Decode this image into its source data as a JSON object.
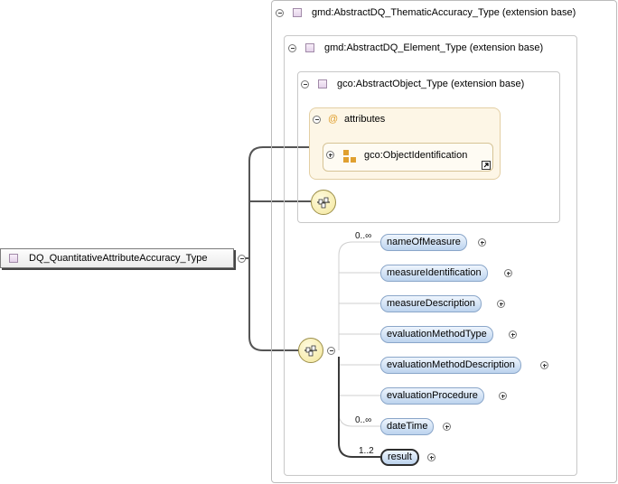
{
  "frames": {
    "outer": "gmd:AbstractDQ_ThematicAccuracy_Type (extension base)",
    "mid": "gmd:AbstractDQ_Element_Type (extension base)",
    "inner": "gco:AbstractObject_Type (extension base)"
  },
  "attributes": {
    "group_label": "attributes",
    "group_symbol": "@",
    "item_label": "gco:ObjectIdentification"
  },
  "root": {
    "label": "DQ_QuantitativeAttributeAccuracy_Type"
  },
  "sequence_elements": [
    {
      "label": "nameOfMeasure",
      "cardinality": "0..∞"
    },
    {
      "label": "measureIdentification",
      "cardinality": ""
    },
    {
      "label": "measureDescription",
      "cardinality": ""
    },
    {
      "label": "evaluationMethodType",
      "cardinality": ""
    },
    {
      "label": "evaluationMethodDescription",
      "cardinality": ""
    },
    {
      "label": "evaluationProcedure",
      "cardinality": ""
    },
    {
      "label": "dateTime",
      "cardinality": "0..∞"
    },
    {
      "label": "result",
      "cardinality": "1..2"
    }
  ],
  "colors": {
    "connector": "#555555",
    "element_fill": "#bcd3ee",
    "attribute_fill": "#fdf6e6",
    "type_icon": "#e4d2ea"
  }
}
